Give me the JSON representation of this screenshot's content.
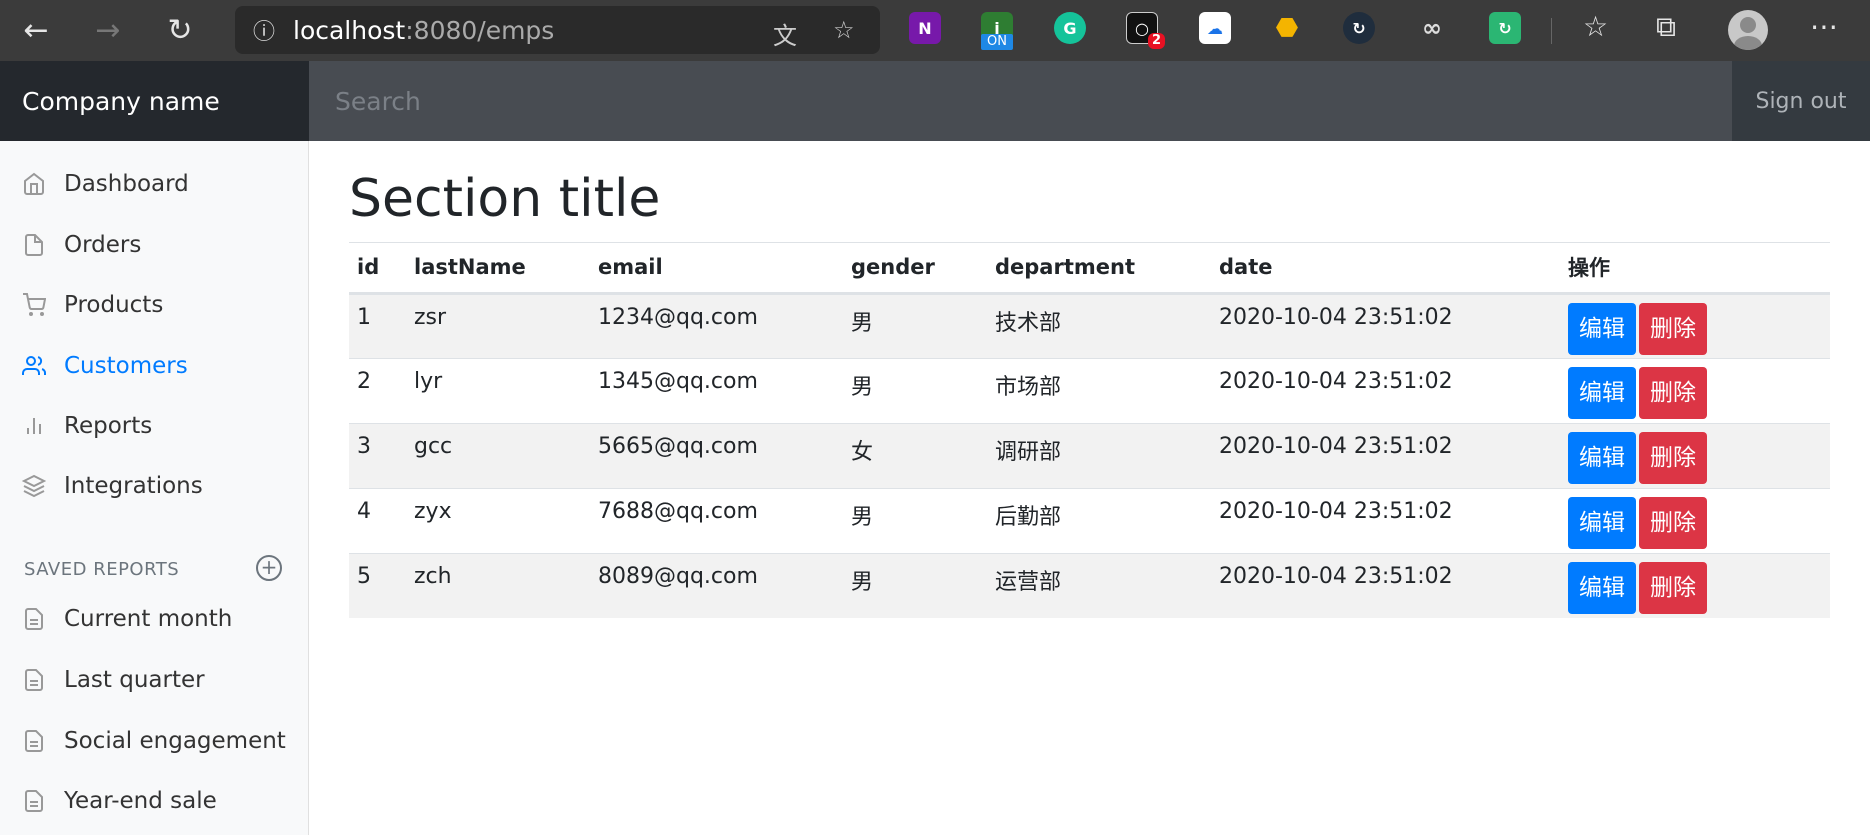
{
  "browser": {
    "url_host": "localhost",
    "url_rest": ":8080/emps",
    "badge_count": "2",
    "ext_on_label": "ON"
  },
  "navbar": {
    "brand": "Company name",
    "search_placeholder": "Search",
    "signout": "Sign out"
  },
  "sidebar": {
    "items": [
      {
        "label": "Dashboard",
        "icon": "home-icon"
      },
      {
        "label": "Orders",
        "icon": "file-icon"
      },
      {
        "label": "Products",
        "icon": "cart-icon"
      },
      {
        "label": "Customers",
        "icon": "users-icon"
      },
      {
        "label": "Reports",
        "icon": "bar-chart-icon"
      },
      {
        "label": "Integrations",
        "icon": "layers-icon"
      }
    ],
    "saved_heading": "SAVED REPORTS",
    "saved": [
      {
        "label": "Current month"
      },
      {
        "label": "Last quarter"
      },
      {
        "label": "Social engagement"
      },
      {
        "label": "Year-end sale"
      }
    ]
  },
  "main": {
    "title": "Section title",
    "columns": [
      "id",
      "lastName",
      "email",
      "gender",
      "department",
      "date",
      "操作"
    ],
    "rows": [
      {
        "id": "1",
        "lastName": "zsr",
        "email": "1234@qq.com",
        "gender": "男",
        "department": "技术部",
        "date": "2020-10-04 23:51:02"
      },
      {
        "id": "2",
        "lastName": "lyr",
        "email": "1345@qq.com",
        "gender": "男",
        "department": "市场部",
        "date": "2020-10-04 23:51:02"
      },
      {
        "id": "3",
        "lastName": "gcc",
        "email": "5665@qq.com",
        "gender": "女",
        "department": "调研部",
        "date": "2020-10-04 23:51:02"
      },
      {
        "id": "4",
        "lastName": "zyx",
        "email": "7688@qq.com",
        "gender": "男",
        "department": "后勤部",
        "date": "2020-10-04 23:51:02"
      },
      {
        "id": "5",
        "lastName": "zch",
        "email": "8089@qq.com",
        "gender": "男",
        "department": "运营部",
        "date": "2020-10-04 23:51:02"
      }
    ],
    "edit_label": "编辑",
    "delete_label": "删除"
  }
}
